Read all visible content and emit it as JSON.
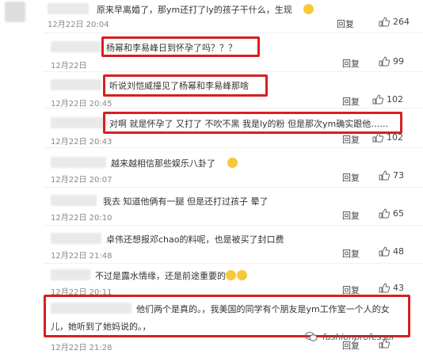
{
  "comments": [
    {
      "text": "原来早离婚了，那ym还打了ly的孩子干什么，生现",
      "time": "12月22日 20:04",
      "reply": "回复",
      "likes": "264"
    },
    {
      "text": "杨幂和李易峰日到怀孕了吗？？？",
      "time": "12月22日",
      "reply": "回复",
      "likes": "99"
    },
    {
      "text": "听说刘恺威撞见了杨幂和李易峰那啥",
      "time": "12月22日 20:45",
      "reply": "回复",
      "likes": "102"
    },
    {
      "text": "对啊 就是怀孕了 又打了 不吹不黑 我是ly的粉 但是那次ym确实跟他……",
      "time": "12月22日 20:43",
      "reply": "回复",
      "likes": "102"
    },
    {
      "text": "越来越相信那些娱乐八卦了",
      "time": "12月22日 20:07",
      "reply": "回复",
      "likes": "73"
    },
    {
      "text": "我去 知道他俩有一腿 但是还打过孩子 晕了",
      "time": "12月22日 20:10",
      "reply": "回复",
      "likes": "65"
    },
    {
      "text": "卓伟还想报邓chao的料呢，也是被买了封口费",
      "time": "12月22日 21:48",
      "reply": "回复",
      "likes": "48"
    },
    {
      "text": "不过是露水情缘，还是前途重要的",
      "time": "12月22日 20:11",
      "reply": "回复",
      "likes": "43"
    },
    {
      "text": "他们两个是真的。，我美国的同学有个朋友是ym工作室一个人的女",
      "text2": "儿，她听到了她妈说的。，",
      "time": "12月22日 21:28",
      "reply": "回复",
      "likes": ""
    }
  ],
  "watermark": "fashionprofessor"
}
